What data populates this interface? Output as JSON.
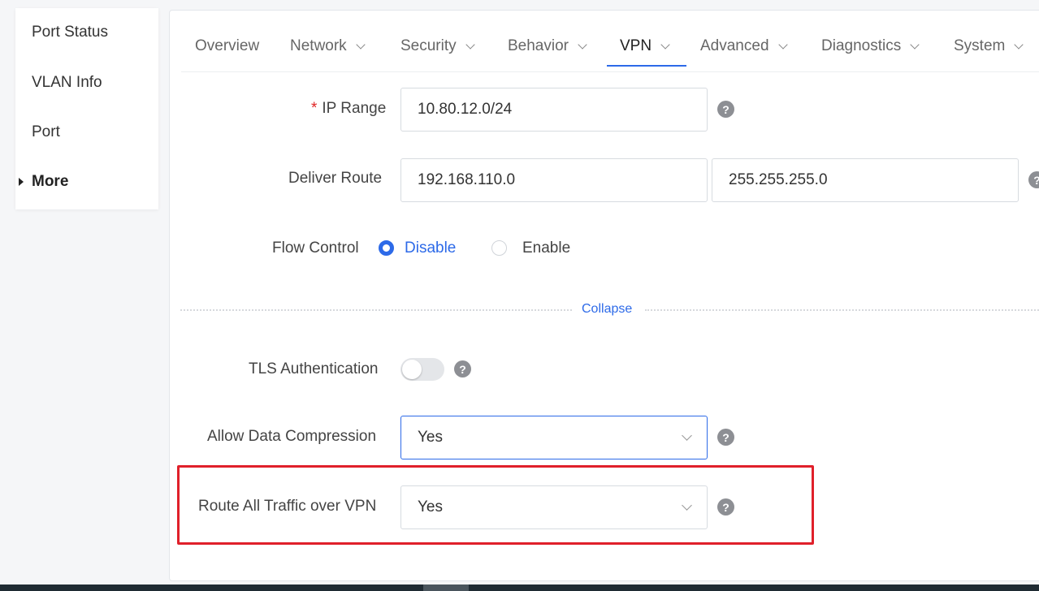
{
  "sidebar": {
    "items": [
      {
        "label": "Port Status"
      },
      {
        "label": "VLAN Info"
      },
      {
        "label": "Port"
      },
      {
        "label": "More"
      }
    ]
  },
  "tabs": [
    {
      "label": "Overview"
    },
    {
      "label": "Network"
    },
    {
      "label": "Security"
    },
    {
      "label": "Behavior"
    },
    {
      "label": "VPN"
    },
    {
      "label": "Advanced"
    },
    {
      "label": "Diagnostics"
    },
    {
      "label": "System"
    }
  ],
  "active_tab": "VPN",
  "form": {
    "ip_range": {
      "required_mark": "*",
      "label": "IP Range",
      "value": "10.80.12.0/24"
    },
    "deliver_route": {
      "label": "Deliver Route",
      "network": "192.168.110.0",
      "mask": "255.255.255.0"
    },
    "flow_control": {
      "label": "Flow Control",
      "option_disable": "Disable",
      "option_enable": "Enable",
      "selected": "Disable"
    },
    "collapse_label": "Collapse",
    "tls_auth": {
      "label": "TLS Authentication",
      "enabled": false
    },
    "data_compression": {
      "label": "Allow Data Compression",
      "value": "Yes"
    },
    "route_all": {
      "label": "Route All Traffic over VPN",
      "value": "Yes"
    },
    "help_glyph": "?"
  },
  "colors": {
    "accent": "#2d6ae8",
    "highlight": "#e0202a",
    "required": "#e02424"
  }
}
